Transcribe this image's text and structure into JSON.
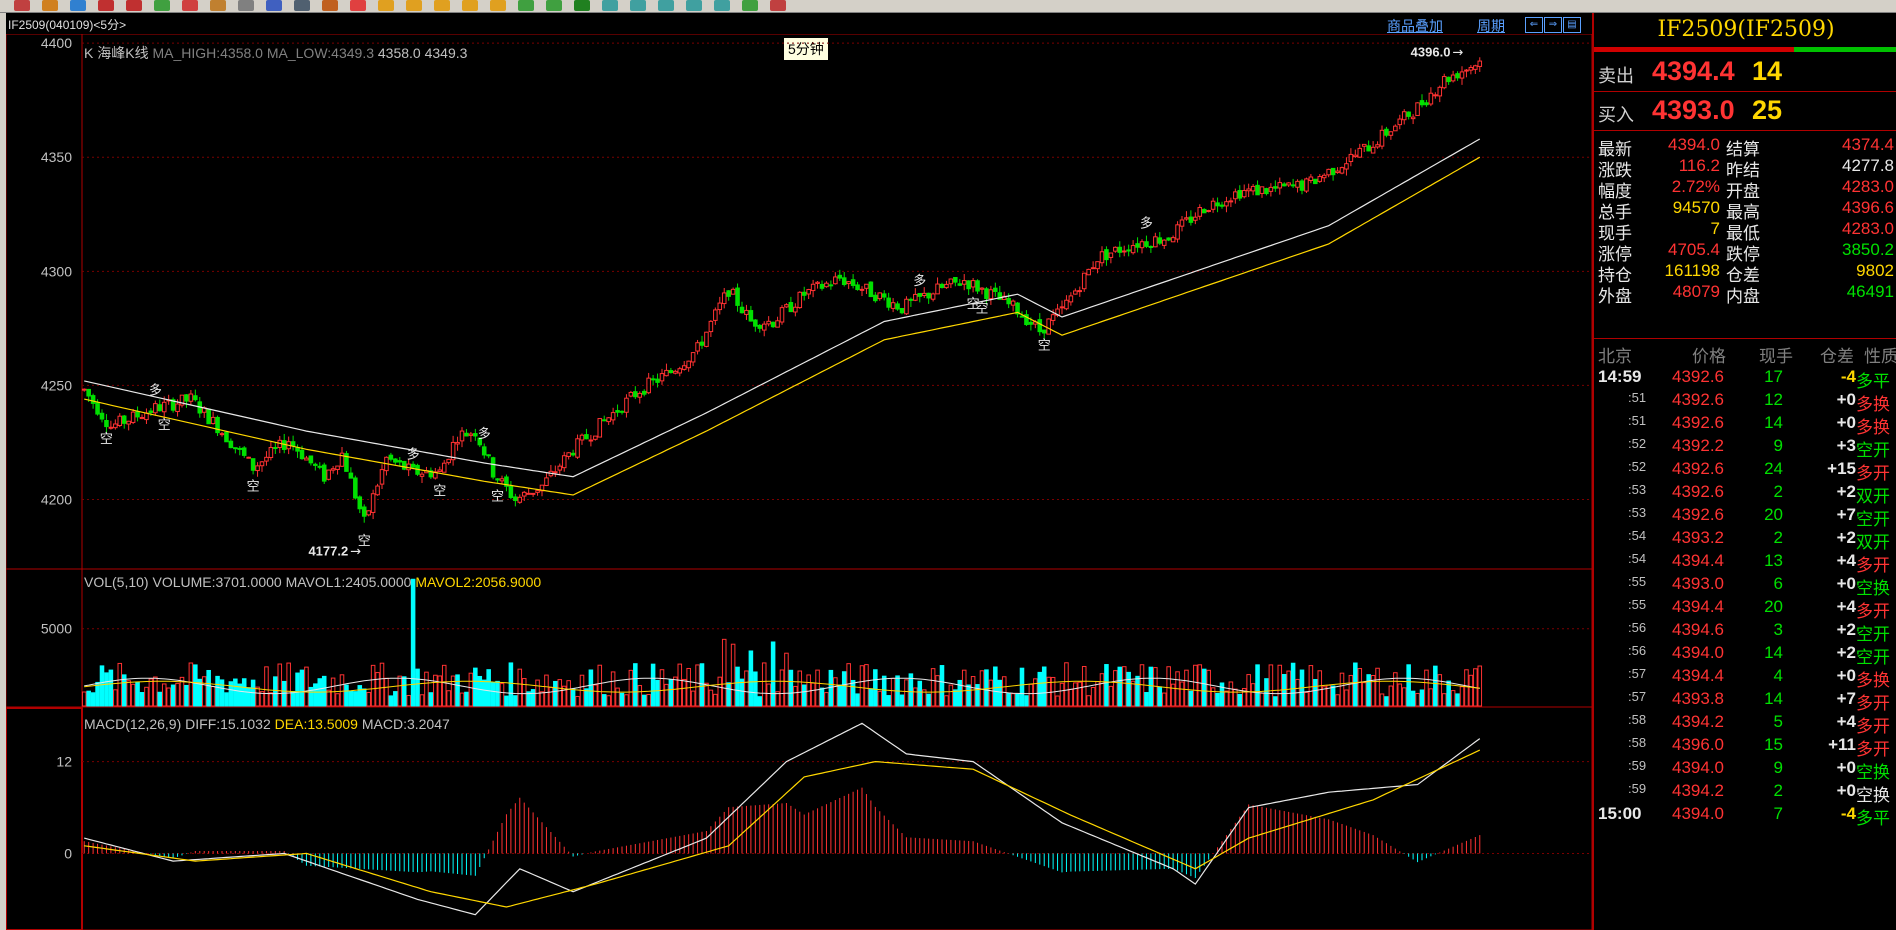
{
  "toolbar": {
    "icons": [
      "home-icon",
      "refresh-icon",
      "draw-icon",
      "zoom-in-icon",
      "zoom-out-icon",
      "indicator-icon",
      "brush-icon",
      "palette-icon",
      "pin-icon",
      "new-icon",
      "list-icon",
      "grid-icon",
      "tick-icon",
      "day-icon",
      "week-icon",
      "month-icon",
      "quarter-icon",
      "year-icon",
      "1min-icon",
      "3min-icon",
      "5min-icon",
      "15min-icon",
      "30min-icon",
      "60min-icon",
      "2h-icon",
      "4h-icon",
      "1h-icon",
      "export-icon"
    ]
  },
  "chart_header": {
    "contract": "IF2509(040109)<5分>",
    "mode_link": "商品叠加",
    "period_link": "周期",
    "period_tooltip": "5分钟"
  },
  "price_legend": {
    "prefix": "K 海峰K线",
    "ma_high": "MA_HIGH:4358.0",
    "ma_low": "MA_LOW:4349.3",
    "values": "4358.0 4349.3"
  },
  "vol_legend": {
    "name": "VOL(5,10)",
    "volume": "VOLUME:3701.0000",
    "mavol1": "MAVOL1:2405.0000",
    "mavol2": "MAVOL2:2056.9000"
  },
  "macd_legend": {
    "name": "MACD(12,26,9)",
    "diff": "DIFF:15.1032",
    "dea": "DEA:13.5009",
    "macd": "MACD:3.2047"
  },
  "chart_data": {
    "type": "candlestick",
    "price_axis": {
      "ticks": [
        "4400",
        "4350",
        "4300",
        "4250",
        "4200"
      ],
      "ylim": [
        4170,
        4404
      ]
    },
    "volume_axis": {
      "ticks": [
        "5000"
      ],
      "ylim": [
        0,
        8800
      ]
    },
    "macd_axis": {
      "ticks": [
        "12",
        "0"
      ],
      "ylim": [
        -10,
        19
      ]
    },
    "high_annotation": "4396.0",
    "low_annotation": "4177.2",
    "signals": [
      {
        "bar": 5,
        "label": "空"
      },
      {
        "bar": 16,
        "label": "多"
      },
      {
        "bar": 18,
        "label": "空"
      },
      {
        "bar": 38,
        "label": "空"
      },
      {
        "bar": 63,
        "label": "空"
      },
      {
        "bar": 74,
        "label": "多"
      },
      {
        "bar": 80,
        "label": "空"
      },
      {
        "bar": 90,
        "label": "多"
      },
      {
        "bar": 93,
        "label": "空"
      },
      {
        "bar": 188,
        "label": "多"
      },
      {
        "bar": 200,
        "label": "空"
      },
      {
        "bar": 202,
        "label": "空"
      },
      {
        "bar": 216,
        "label": "空"
      },
      {
        "bar": 239,
        "label": "多"
      }
    ],
    "anchors": [
      [
        0,
        4248
      ],
      [
        6,
        4232
      ],
      [
        16,
        4240
      ],
      [
        24,
        4244
      ],
      [
        30,
        4232
      ],
      [
        38,
        4214
      ],
      [
        46,
        4226
      ],
      [
        54,
        4210
      ],
      [
        58,
        4220
      ],
      [
        63,
        4190
      ],
      [
        68,
        4218
      ],
      [
        74,
        4212
      ],
      [
        80,
        4212
      ],
      [
        84,
        4228
      ],
      [
        88,
        4230
      ],
      [
        92,
        4212
      ],
      [
        97,
        4200
      ],
      [
        103,
        4206
      ],
      [
        110,
        4222
      ],
      [
        118,
        4236
      ],
      [
        125,
        4248
      ],
      [
        132,
        4256
      ],
      [
        138,
        4266
      ],
      [
        145,
        4292
      ],
      [
        150,
        4278
      ],
      [
        155,
        4278
      ],
      [
        162,
        4290
      ],
      [
        170,
        4297
      ],
      [
        178,
        4290
      ],
      [
        184,
        4284
      ],
      [
        192,
        4292
      ],
      [
        198,
        4296
      ],
      [
        204,
        4290
      ],
      [
        210,
        4283
      ],
      [
        215,
        4274
      ],
      [
        220,
        4283
      ],
      [
        228,
        4306
      ],
      [
        236,
        4312
      ],
      [
        244,
        4315
      ],
      [
        252,
        4328
      ],
      [
        260,
        4335
      ],
      [
        268,
        4336
      ],
      [
        275,
        4338
      ],
      [
        282,
        4346
      ],
      [
        290,
        4356
      ],
      [
        300,
        4372
      ],
      [
        306,
        4384
      ],
      [
        314,
        4392
      ]
    ],
    "ma_anchors": [
      [
        0,
        4252
      ],
      [
        50,
        4230
      ],
      [
        90,
        4216
      ],
      [
        110,
        4210
      ],
      [
        140,
        4238
      ],
      [
        180,
        4278
      ],
      [
        210,
        4290
      ],
      [
        220,
        4280
      ],
      [
        250,
        4300
      ],
      [
        280,
        4320
      ],
      [
        314,
        4358
      ]
    ],
    "macd_diff_anchors": [
      [
        0,
        2
      ],
      [
        20,
        -1
      ],
      [
        45,
        0
      ],
      [
        75,
        -6
      ],
      [
        88,
        -8
      ],
      [
        98,
        -2
      ],
      [
        110,
        -5
      ],
      [
        140,
        2
      ],
      [
        158,
        12
      ],
      [
        175,
        17
      ],
      [
        185,
        13
      ],
      [
        200,
        12
      ],
      [
        220,
        4
      ],
      [
        245,
        -2
      ],
      [
        250,
        -4
      ],
      [
        262,
        6
      ],
      [
        280,
        8
      ],
      [
        300,
        9
      ],
      [
        314,
        15
      ]
    ],
    "macd_dea_anchors": [
      [
        0,
        1
      ],
      [
        25,
        -1
      ],
      [
        50,
        0
      ],
      [
        78,
        -5
      ],
      [
        95,
        -7
      ],
      [
        115,
        -4
      ],
      [
        145,
        1
      ],
      [
        162,
        10
      ],
      [
        178,
        12
      ],
      [
        200,
        11
      ],
      [
        222,
        5
      ],
      [
        250,
        -2
      ],
      [
        262,
        2
      ],
      [
        290,
        7
      ],
      [
        314,
        13.5
      ]
    ],
    "volume_spike": {
      "bar": 74,
      "value": 8200
    }
  },
  "quote": {
    "title": "IF2509(IF2509)",
    "sell_label": "卖出",
    "sell_price": "4394.4",
    "sell_vol": "14",
    "buy_label": "买入",
    "buy_price": "4393.0",
    "buy_vol": "25",
    "stats": [
      {
        "l1": "最新",
        "v1": "4394.0",
        "c1": "red",
        "l2": "结算",
        "v2": "4374.4",
        "c2": "red"
      },
      {
        "l1": "涨跌",
        "v1": "116.2",
        "c1": "red",
        "l2": "昨结",
        "v2": "4277.8",
        "c2": "wht"
      },
      {
        "l1": "幅度",
        "v1": "2.72%",
        "c1": "red",
        "l2": "开盘",
        "v2": "4283.0",
        "c2": "red"
      },
      {
        "l1": "总手",
        "v1": "94570",
        "c1": "yel",
        "l2": "最高",
        "v2": "4396.6",
        "c2": "red"
      },
      {
        "l1": "现手",
        "v1": "7",
        "c1": "yel",
        "l2": "最低",
        "v2": "4283.0",
        "c2": "red"
      },
      {
        "l1": "涨停",
        "v1": "4705.4",
        "c1": "red",
        "l2": "跌停",
        "v2": "3850.2",
        "c2": "grn"
      },
      {
        "l1": "持仓",
        "v1": "161198",
        "c1": "yel",
        "l2": "仓差",
        "v2": "9802",
        "c2": "yel"
      },
      {
        "l1": "外盘",
        "v1": "48079",
        "c1": "red",
        "l2": "内盘",
        "v2": "46491",
        "c2": "grn"
      }
    ],
    "tick_headers": {
      "time": "北京",
      "price": "价格",
      "vol": "现手",
      "oi": "仓差",
      "type": "性质"
    },
    "ticks": [
      {
        "t": "14:59",
        "p": "4392.6",
        "v": "17",
        "oi": "-4",
        "ty": "多平",
        "tyc": "grn"
      },
      {
        "t": ":51",
        "p": "4392.6",
        "v": "12",
        "oi": "+0",
        "ty": "多换",
        "tyc": "red"
      },
      {
        "t": ":51",
        "p": "4392.6",
        "v": "14",
        "oi": "+0",
        "ty": "多换",
        "tyc": "red"
      },
      {
        "t": ":52",
        "p": "4392.2",
        "v": "9",
        "oi": "+3",
        "ty": "空开",
        "tyc": "grn"
      },
      {
        "t": ":52",
        "p": "4392.6",
        "v": "24",
        "oi": "+15",
        "ty": "多开",
        "tyc": "red"
      },
      {
        "t": ":53",
        "p": "4392.6",
        "v": "2",
        "oi": "+2",
        "ty": "双开",
        "tyc": "grn"
      },
      {
        "t": ":53",
        "p": "4392.6",
        "v": "20",
        "oi": "+7",
        "ty": "空开",
        "tyc": "grn"
      },
      {
        "t": ":54",
        "p": "4393.2",
        "v": "2",
        "oi": "+2",
        "ty": "双开",
        "tyc": "grn"
      },
      {
        "t": ":54",
        "p": "4394.4",
        "v": "13",
        "oi": "+4",
        "ty": "多开",
        "tyc": "red"
      },
      {
        "t": ":55",
        "p": "4393.0",
        "v": "6",
        "oi": "+0",
        "ty": "空换",
        "tyc": "grn"
      },
      {
        "t": ":55",
        "p": "4394.4",
        "v": "20",
        "oi": "+4",
        "ty": "多开",
        "tyc": "red"
      },
      {
        "t": ":56",
        "p": "4394.6",
        "v": "3",
        "oi": "+2",
        "ty": "空开",
        "tyc": "grn"
      },
      {
        "t": ":56",
        "p": "4394.0",
        "v": "14",
        "oi": "+2",
        "ty": "空开",
        "tyc": "grn"
      },
      {
        "t": ":57",
        "p": "4394.4",
        "v": "4",
        "oi": "+0",
        "ty": "多换",
        "tyc": "red"
      },
      {
        "t": ":57",
        "p": "4393.8",
        "v": "14",
        "oi": "+7",
        "ty": "多开",
        "tyc": "red"
      },
      {
        "t": ":58",
        "p": "4394.2",
        "v": "5",
        "oi": "+4",
        "ty": "多开",
        "tyc": "red"
      },
      {
        "t": ":58",
        "p": "4396.0",
        "v": "15",
        "oi": "+11",
        "ty": "多开",
        "tyc": "red"
      },
      {
        "t": ":59",
        "p": "4394.0",
        "v": "9",
        "oi": "+0",
        "ty": "空换",
        "tyc": "grn"
      },
      {
        "t": ":59",
        "p": "4394.2",
        "v": "2",
        "oi": "+0",
        "ty": "空换",
        "tyc": "wht"
      },
      {
        "t": "15:00",
        "p": "4394.0",
        "v": "7",
        "oi": "-4",
        "ty": "多平",
        "tyc": "grn"
      }
    ]
  }
}
